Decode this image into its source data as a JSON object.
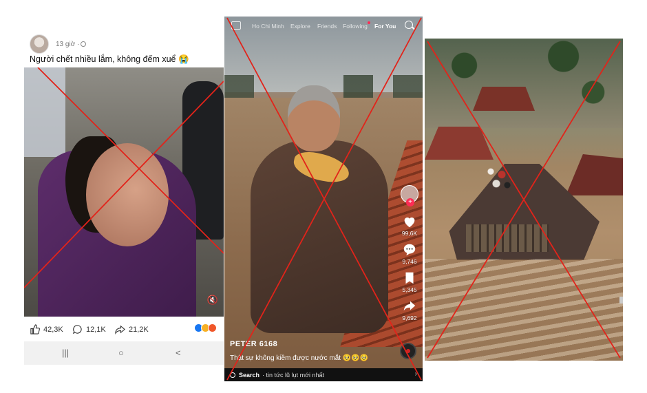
{
  "facebook_post": {
    "time": "13 giờ",
    "caption": "Người chết nhiều lắm, không đếm xuể 😭",
    "likes": "42,3K",
    "comments": "12,1K",
    "shares": "21,2K",
    "nav": {
      "recents": "|||",
      "home": "○",
      "back": "<"
    }
  },
  "tiktok": {
    "tabs": [
      "Ho Chi Minh",
      "Explore",
      "Friends",
      "Following",
      "For You"
    ],
    "active_tab": "For You",
    "counts": {
      "likes": "99,6K",
      "comments": "9,746",
      "saves": "5,345",
      "shares": "9,692"
    },
    "username": "PETER 6168",
    "description": "Thật sự không kiềm được nước mắt 🥺🥺🥺",
    "search": {
      "label": "Search",
      "query": "· tin tức lũ lụt mới nhất",
      "chevron": "›"
    }
  },
  "colors": {
    "cross": "#e2231a",
    "tiktok_red": "#fe2c55"
  }
}
